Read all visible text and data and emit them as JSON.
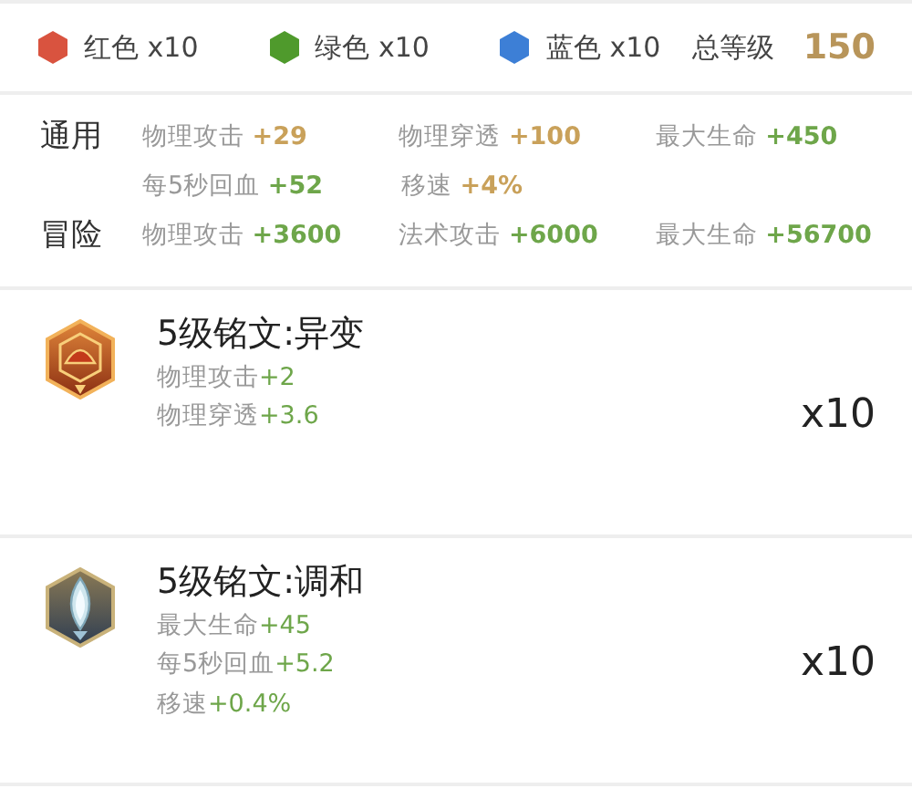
{
  "gems": [
    {
      "label": "红色 x10",
      "color": "#d9533f"
    },
    {
      "label": "绿色 x10",
      "color": "#4f9a2c"
    },
    {
      "label": "蓝色 x10",
      "color": "#3d7fd6"
    }
  ],
  "total": {
    "label": "总等级",
    "value": "150"
  },
  "stat_groups": [
    {
      "label": "通用",
      "rows": [
        [
          {
            "name": "物理攻击",
            "value": "+29",
            "color": "#c9a15a"
          },
          {
            "name": "物理穿透",
            "value": "+100",
            "color": "#c9a15a"
          },
          {
            "name": "最大生命",
            "value": "+450",
            "color": "#6ea64a"
          }
        ],
        [
          {
            "name": "每5秒回血",
            "value": "+52",
            "color": "#6ea64a"
          },
          {
            "name": "移速",
            "value": "+4%",
            "color": "#c9a15a"
          }
        ]
      ]
    },
    {
      "label": "冒险",
      "rows": [
        [
          {
            "name": "物理攻击",
            "value": "+3600",
            "color": "#6ea64a"
          },
          {
            "name": "法术攻击",
            "value": "+6000",
            "color": "#6ea64a"
          },
          {
            "name": "最大生命",
            "value": "+56700",
            "color": "#6ea64a"
          }
        ]
      ]
    }
  ],
  "inscriptions": [
    {
      "title": "5级铭文:异变",
      "kind": "red",
      "count": "x10",
      "stats": [
        {
          "name": "物理攻击",
          "value": "+2"
        },
        {
          "name": "物理穿透",
          "value": "+3.6"
        }
      ]
    },
    {
      "title": "5级铭文:调和",
      "kind": "blue",
      "count": "x10",
      "stats": [
        {
          "name": "最大生命",
          "value": "+45"
        },
        {
          "name": "每5秒回血",
          "value": "+5.2"
        },
        {
          "name": "移速",
          "value": "+0.4%"
        }
      ]
    }
  ]
}
